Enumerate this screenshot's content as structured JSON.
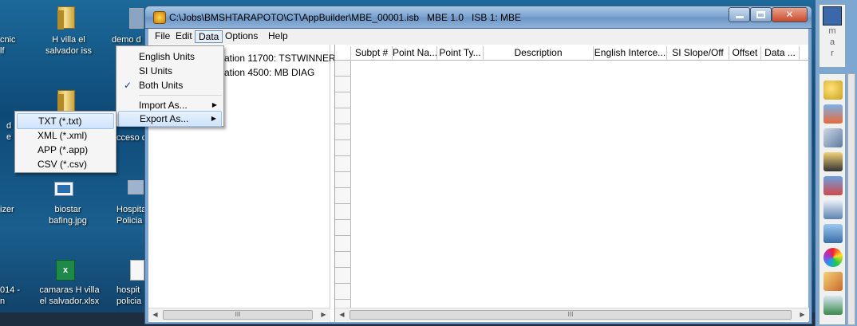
{
  "desktop": {
    "icons": [
      {
        "label": "cnic\nlf"
      },
      {
        "label": "H villa el\nsalvador iss"
      },
      {
        "label": "demo d"
      },
      {
        "label": "d\ne"
      },
      {
        "label": "cceso c"
      },
      {
        "label": "izer"
      },
      {
        "label": "biostar\nbafing.jpg"
      },
      {
        "label": "Hospital\nPolicia"
      },
      {
        "label": "014 -\nn"
      },
      {
        "label": "camaras H villa\nel salvador.xlsx"
      },
      {
        "label": "hospit\npolicia"
      }
    ]
  },
  "window": {
    "title": "C:\\Jobs\\BMSHTARAPOTO\\CT\\AppBuilder\\MBE_00001.isb   MBE 1.0   ISB 1: MBE",
    "menubar": [
      "File",
      "Edit",
      "Data",
      "Options",
      "Help"
    ],
    "tree": [
      "cation 11700: TSTWINNER",
      "cation 4500: MB DIAG"
    ],
    "grid_columns": [
      "Subpt #",
      "Point Na...",
      "Point Ty...",
      "Description",
      "English Interce...",
      "SI Slope/Off",
      "Offset",
      "Data ..."
    ],
    "scroll_mark": "III"
  },
  "data_menu": {
    "items": [
      {
        "label": "English Units",
        "checked": false
      },
      {
        "label": "SI Units",
        "checked": false
      },
      {
        "label": "Both Units",
        "checked": true
      },
      {
        "label": "Import As...",
        "submenu": true
      },
      {
        "label": "Export As...",
        "submenu": true,
        "highlighted": true
      }
    ]
  },
  "export_menu": {
    "items": [
      "TXT (*.txt)",
      "XML (*.xml)",
      "APP (*.app)",
      "CSV (*.csv)"
    ],
    "highlighted": "TXT (*.txt)"
  },
  "right_strip": {
    "label": "m\na\nr"
  }
}
